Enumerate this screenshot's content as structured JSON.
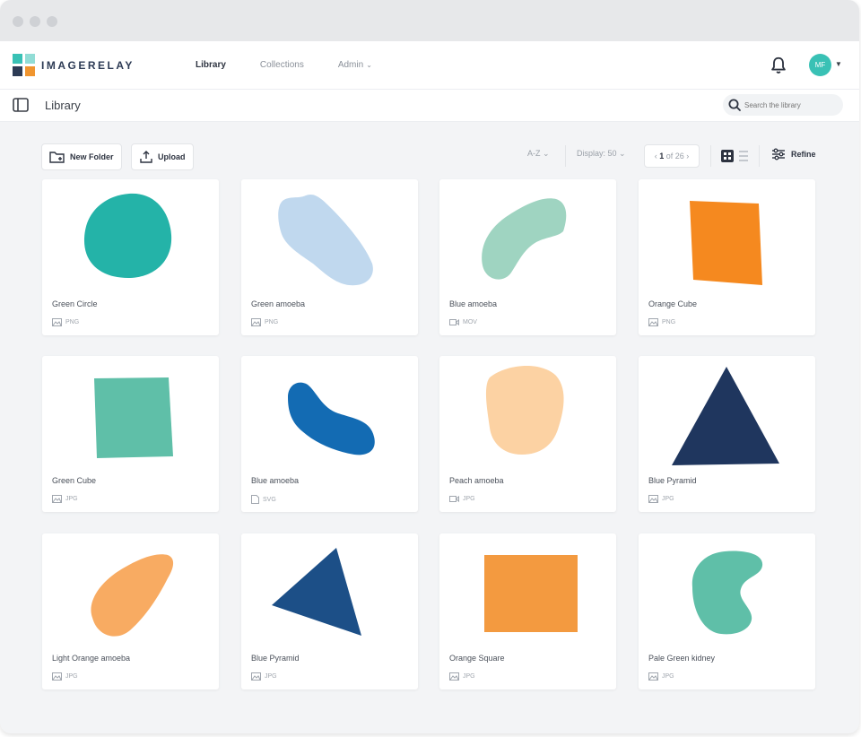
{
  "app": {
    "logo_text": "IMAGERELAY",
    "nav": [
      {
        "label": "Library",
        "active": true
      },
      {
        "label": "Collections",
        "active": false
      },
      {
        "label": "Admin",
        "active": false,
        "dropdown": true
      }
    ],
    "avatar_initials": "MF",
    "colors": {
      "accent": "#39c1b5",
      "logo_teal": "#39c1b5",
      "logo_orange": "#f0952f",
      "logo_blue": "#2d3b55"
    }
  },
  "header": {
    "title": "Library",
    "search_placeholder": "Search the library"
  },
  "toolbar": {
    "new_folder_label": "New Folder",
    "upload_label": "Upload",
    "sort_label": "A-Z",
    "display_label": "Display: 50",
    "page_current": "1",
    "page_suffix": "of 26",
    "refine_label": "Refine"
  },
  "assets": [
    {
      "name": "Green Circle",
      "type": "PNG",
      "file_icon": "image-file-icon",
      "color": "#24b3a8"
    },
    {
      "name": "Green amoeba",
      "type": "PNG",
      "file_icon": "image-file-icon",
      "color": "#c0d8ee"
    },
    {
      "name": "Blue amoeba",
      "type": "MOV",
      "file_icon": "video-file-icon",
      "color": "#9fd4c1"
    },
    {
      "name": "Orange Cube",
      "type": "PNG",
      "file_icon": "image-file-icon",
      "color": "#f5891f"
    },
    {
      "name": "Green Cube",
      "type": "JPG",
      "file_icon": "image-file-icon",
      "color": "#5fbfa8"
    },
    {
      "name": "Blue amoeba",
      "type": "SVG",
      "file_icon": "document-file-icon",
      "color": "#136bb3"
    },
    {
      "name": "Peach amoeba",
      "type": "JPG",
      "file_icon": "video-file-icon",
      "color": "#fcd2a3"
    },
    {
      "name": "Blue Pyramid",
      "type": "JPG",
      "file_icon": "image-file-icon",
      "color": "#1f365e"
    },
    {
      "name": "Light Orange amoeba",
      "type": "JPG",
      "file_icon": "image-file-icon",
      "color": "#f8ab62"
    },
    {
      "name": "Blue Pyramid",
      "type": "JPG",
      "file_icon": "image-file-icon",
      "color": "#1c4f87"
    },
    {
      "name": "Orange Square",
      "type": "JPG",
      "file_icon": "image-file-icon",
      "color": "#f39a40"
    },
    {
      "name": "Pale Green kidney",
      "type": "JPG",
      "file_icon": "image-file-icon",
      "color": "#5fbfa8"
    }
  ]
}
